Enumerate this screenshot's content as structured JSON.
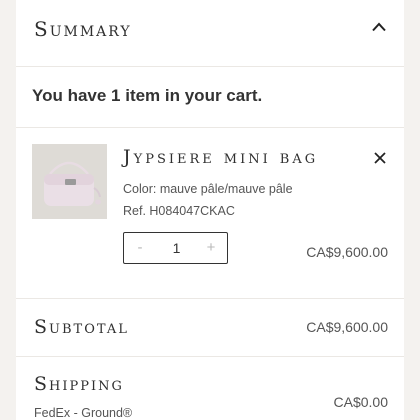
{
  "summary": {
    "title": "Summary"
  },
  "cart": {
    "count_text": "You have 1 item in your cart."
  },
  "item": {
    "name": "Jypsiere mini bag",
    "color": "Color: mauve pâle/mauve pâle",
    "ref": "Ref. H084047CKAC",
    "quantity": "1",
    "minus": "-",
    "plus": "+",
    "price": "CA$9,600.00"
  },
  "totals": {
    "subtotal_label": "Subtotal",
    "subtotal_value": "CA$9,600.00",
    "shipping_label": "Shipping",
    "shipping_value": "CA$0.00",
    "shipping_method": "FedEx - Ground®"
  },
  "icons": {
    "collapse": "chevron-up-icon",
    "remove": "close-icon"
  },
  "colors": {
    "page_background": "#f4f2ef",
    "panel_background": "#ffffff",
    "divider": "#ebe8e4",
    "text": "#2b2b2b"
  }
}
